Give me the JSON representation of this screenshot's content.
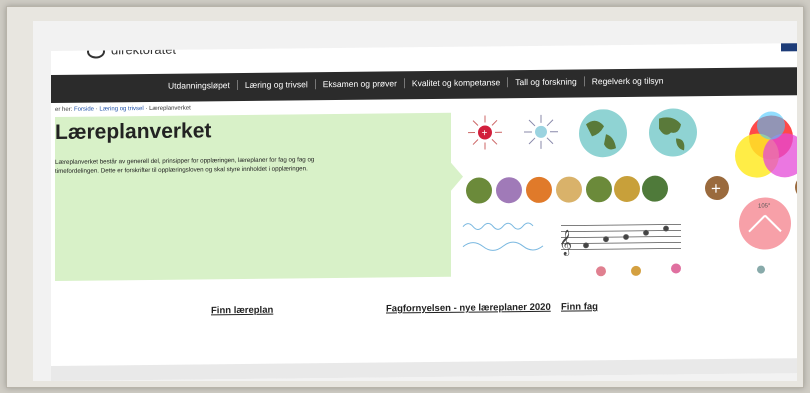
{
  "header": {
    "logo_text": "direktoratet"
  },
  "nav": {
    "items": [
      "Utdanningsløpet",
      "Læring og trivsel",
      "Eksamen og prøver",
      "Kvalitet og kompetanse",
      "Tall og forskning",
      "Regelverk og tilsyn"
    ]
  },
  "breadcrumb": {
    "prefix": "er her:",
    "items": [
      "Forside",
      "Læring og trivsel",
      "Læreplanverket"
    ]
  },
  "hero": {
    "title": "Læreplanverket",
    "lead": "Læreplanverket består av generell del, prinsipper for opplæringen, læreplaner for fag og fag og timefordelingen. Dette er forskrifter til opplæringsloven og skal styre innholdet i opplæringen."
  },
  "art": {
    "angle_label": "105°"
  },
  "links": [
    "Finn læreplan",
    "Fagfornyelsen - nye læreplaner 2020",
    "Finn fag"
  ],
  "colors": {
    "nav_bg": "#2b2b2b",
    "hero_bg": "#d8f1c8",
    "link_blue": "#1d4fa8",
    "icon_brown": "#9a6a3d"
  }
}
